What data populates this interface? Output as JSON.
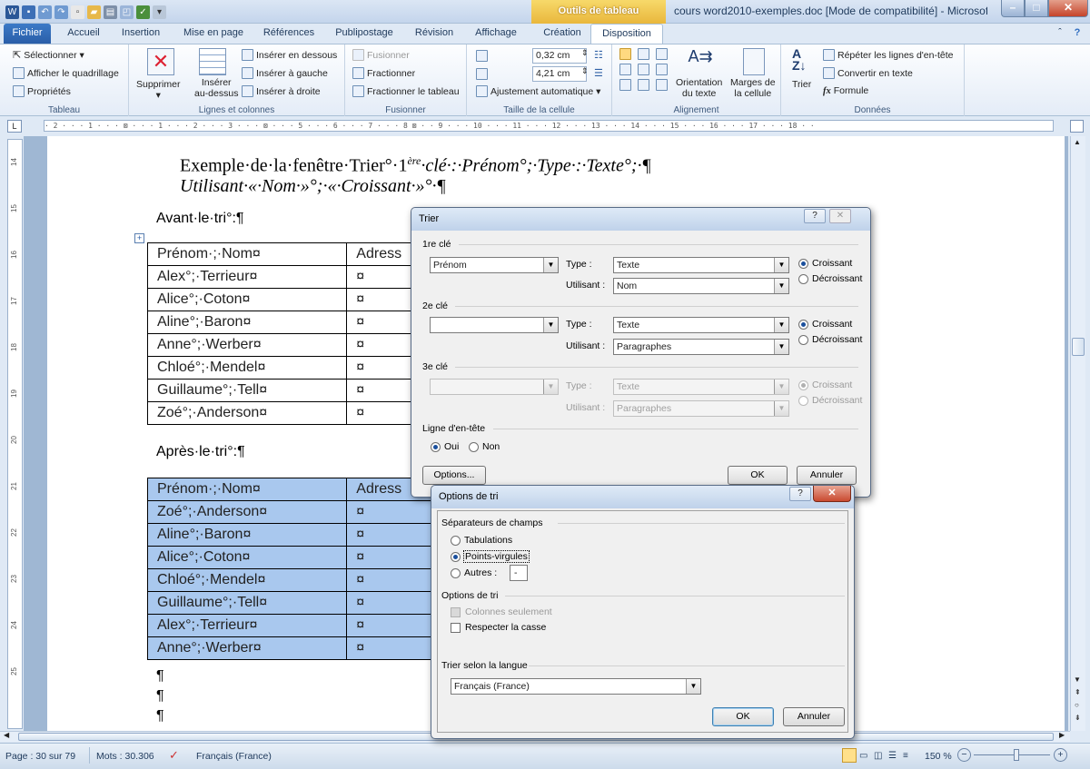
{
  "window": {
    "title": "cours word2010-exemples.doc [Mode de compatibilité] - Microsoft ...",
    "context_tab_group": "Outils de tableau",
    "controls": [
      "–",
      "□",
      "✕"
    ]
  },
  "tabs": [
    "Fichier",
    "Accueil",
    "Insertion",
    "Mise en page",
    "Références",
    "Publipostage",
    "Révision",
    "Affichage",
    "Création",
    "Disposition"
  ],
  "ribbon": {
    "tableau": {
      "label": "Tableau",
      "items": [
        "Sélectionner ▾",
        "Afficher le quadrillage",
        "Propriétés"
      ]
    },
    "lignes_colonnes": {
      "label": "Lignes et colonnes",
      "supprimer": "Supprimer",
      "inserer_dessus_1": "Insérer",
      "inserer_dessus_2": "au-dessus",
      "items": [
        "Insérer en dessous",
        "Insérer à gauche",
        "Insérer à droite"
      ]
    },
    "fusionner": {
      "label": "Fusionner",
      "items": [
        "Fusionner",
        "Fractionner",
        "Fractionner le tableau"
      ]
    },
    "taille": {
      "label": "Taille de la cellule",
      "height": "0,32 cm",
      "width": "4,21 cm",
      "auto": "Ajustement automatique ▾"
    },
    "alignement": {
      "label": "Alignement",
      "orientation_1": "Orientation",
      "orientation_2": "du texte",
      "marges_1": "Marges de",
      "marges_2": "la cellule"
    },
    "donnees": {
      "label": "Données",
      "trier": "Trier",
      "items": [
        "Répéter les lignes d'en-tête",
        "Convertir en texte",
        "Formule"
      ],
      "formula_icon": "fx"
    }
  },
  "ruler_text": "· 2 · · · 1 · · · ⊠ · · · 1 · · · 2 · · · 3 · · · ⊠ · · · 5 · · · 6 · · · 7 · · · 8 ⊠ · · 9 · · · 10 · · · 11 · · · 12 · · · 13 · · · 14 · · · 15 · · · 16 · · · 17 · · · 18 · ·",
  "vruler_numbers": [
    "14",
    "15",
    "16",
    "17",
    "18",
    "19",
    "20",
    "21",
    "22",
    "23",
    "24",
    "25"
  ],
  "document": {
    "heading_line1_a": "Exemple·de·la·fenêtre·Trier°·1",
    "heading_line1_sup": "ère",
    "heading_line1_b": "·clé·:·Prénom°;·Type·:·Texte°;·¶",
    "heading_line2": "Utilisant·«·Nom·»°;·«·Croissant·»°·¶",
    "before": "Avant·le·tri°:¶",
    "after": "Après·le·tri°:¶",
    "table_before": [
      [
        "Prénom·;·Nom¤",
        "Adress"
      ],
      [
        "Alex°;·Terrieur¤",
        "¤"
      ],
      [
        "Alice°;·Coton¤",
        "¤"
      ],
      [
        "Aline°;·Baron¤",
        "¤"
      ],
      [
        "Anne°;·Werber¤",
        "¤"
      ],
      [
        "Chloé°;·Mendel¤",
        "¤"
      ],
      [
        "Guillaume°;·Tell¤",
        "¤"
      ],
      [
        "Zoé°;·Anderson¤",
        "¤"
      ]
    ],
    "table_after": [
      [
        "Prénom·;·Nom¤",
        "Adress"
      ],
      [
        "Zoé°;·Anderson¤",
        "¤"
      ],
      [
        "Aline°;·Baron¤",
        "¤"
      ],
      [
        "Alice°;·Coton¤",
        "¤"
      ],
      [
        "Chloé°;·Mendel¤",
        "¤"
      ],
      [
        "Guillaume°;·Tell¤",
        "¤"
      ],
      [
        "Alex°;·Terrieur¤",
        "¤"
      ],
      [
        "Anne°;·Werber¤",
        "¤"
      ]
    ],
    "pilcrows": [
      "¶",
      "¶",
      "¶"
    ]
  },
  "trier_dialog": {
    "title": "Trier",
    "help": "?",
    "close": "✕",
    "key1": {
      "label": "1re clé",
      "field": "Prénom",
      "type_label": "Type :",
      "type": "Texte",
      "using_label": "Utilisant :",
      "using": "Nom",
      "asc": "Croissant",
      "desc": "Décroissant"
    },
    "key2": {
      "label": "2e clé",
      "field": "",
      "type_label": "Type :",
      "type": "Texte",
      "using_label": "Utilisant :",
      "using": "Paragraphes",
      "asc": "Croissant",
      "desc": "Décroissant"
    },
    "key3": {
      "label": "3e clé",
      "field": "",
      "type_label": "Type :",
      "type": "Texte",
      "using_label": "Utilisant :",
      "using": "Paragraphes",
      "asc": "Croissant",
      "desc": "Décroissant"
    },
    "header_row": {
      "label": "Ligne d'en-tête",
      "yes": "Oui",
      "no": "Non"
    },
    "options": "Options...",
    "ok": "OK",
    "cancel": "Annuler"
  },
  "options_dialog": {
    "title": "Options de tri",
    "help": "?",
    "close": "✕",
    "separators_label": "Séparateurs de champs",
    "tabs": "Tabulations",
    "semicolons": "Points-virgules",
    "others": "Autres :",
    "others_value": "-",
    "sort_options_label": "Options de tri",
    "columns_only": "Colonnes seulement",
    "case_sensitive": "Respecter la casse",
    "language_label": "Trier selon la langue",
    "language": "Français (France)",
    "ok": "OK",
    "cancel": "Annuler"
  },
  "status": {
    "page": "Page : 30 sur 79",
    "words": "Mots : 30.306",
    "language": "Français (France)",
    "zoom": "150 %"
  }
}
